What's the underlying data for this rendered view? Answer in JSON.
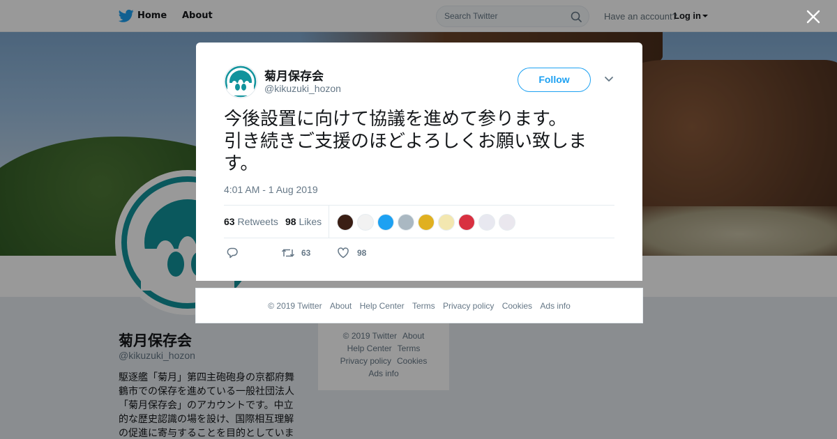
{
  "nav": {
    "home_label": "Home",
    "about_label": "About",
    "search_placeholder": "Search Twitter",
    "have_account": "Have an account?",
    "login_label": "Log in"
  },
  "profile": {
    "name": "菊月保存会",
    "handle": "@kikuzuki_hozon",
    "bio": "駆逐艦「菊月」第四主砲砲身の京都府舞鶴市での保存を進めている一般社団法人「菊月保存会」のアカウントです。中立的な歴史認識の場を設け、国際相互理解の促進に寄与することを目的としていま"
  },
  "side_footer": {
    "links": [
      "© 2019 Twitter",
      "About",
      "Help Center",
      "Terms",
      "Privacy policy",
      "Cookies",
      "Ads info"
    ]
  },
  "tweet": {
    "name": "菊月保存会",
    "handle": "@kikuzuki_hozon",
    "follow_label": "Follow",
    "text": "今後設置に向けて協議を進めて参ります。\n引き続きご支援のほどよろしくお願い致します。",
    "timestamp": "4:01 AM - 1 Aug 2019",
    "retweets_count": "63",
    "retweets_label": "Retweets",
    "likes_count": "98",
    "likes_label": "Likes",
    "action_retweet_count": "63",
    "action_like_count": "98",
    "liker_colors": [
      "#3a1e14",
      "#f2f2f2",
      "#1da1f2",
      "#aab8c2",
      "#e0b020",
      "#f3e7b0",
      "#d83040",
      "#e8e8f0",
      "#eae7ee"
    ]
  },
  "modal_footer": {
    "links": [
      "© 2019 Twitter",
      "About",
      "Help Center",
      "Terms",
      "Privacy policy",
      "Cookies",
      "Ads info"
    ]
  },
  "colors": {
    "accent": "#1da1f2",
    "brand_teal": "#11939c"
  }
}
